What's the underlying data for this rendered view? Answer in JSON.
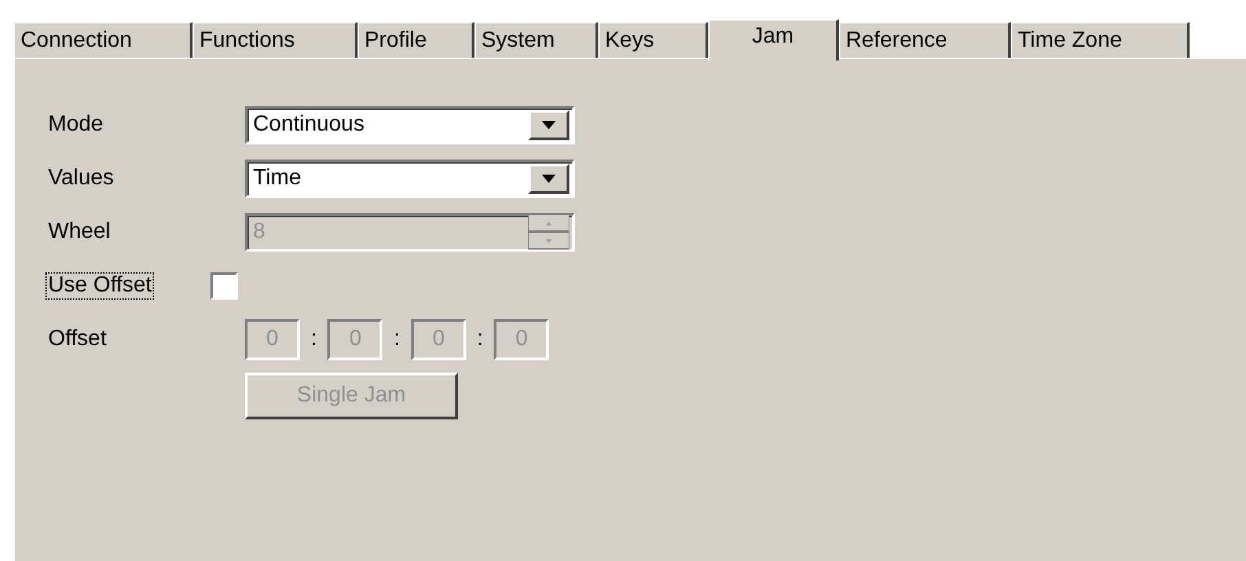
{
  "tabs": [
    {
      "label": "Connection",
      "selected": false
    },
    {
      "label": "Functions",
      "selected": false
    },
    {
      "label": "Profile",
      "selected": false
    },
    {
      "label": "System",
      "selected": false
    },
    {
      "label": "Keys",
      "selected": false
    },
    {
      "label": "Jam",
      "selected": true
    },
    {
      "label": "Reference",
      "selected": false
    },
    {
      "label": "Time Zone",
      "selected": false
    }
  ],
  "mode": {
    "label": "Mode",
    "value": "Continuous"
  },
  "values": {
    "label": "Values",
    "value": "Time"
  },
  "wheel": {
    "label": "Wheel",
    "value": "8",
    "disabled": true
  },
  "use_offset": {
    "label": "Use Offset",
    "checked": false,
    "focused": true
  },
  "offset": {
    "label": "Offset",
    "disabled": true,
    "fields": [
      "0",
      "0",
      "0",
      "0"
    ],
    "separators": [
      ":",
      ":",
      ":"
    ]
  },
  "single_jam_button": {
    "label": "Single Jam",
    "disabled": true
  }
}
